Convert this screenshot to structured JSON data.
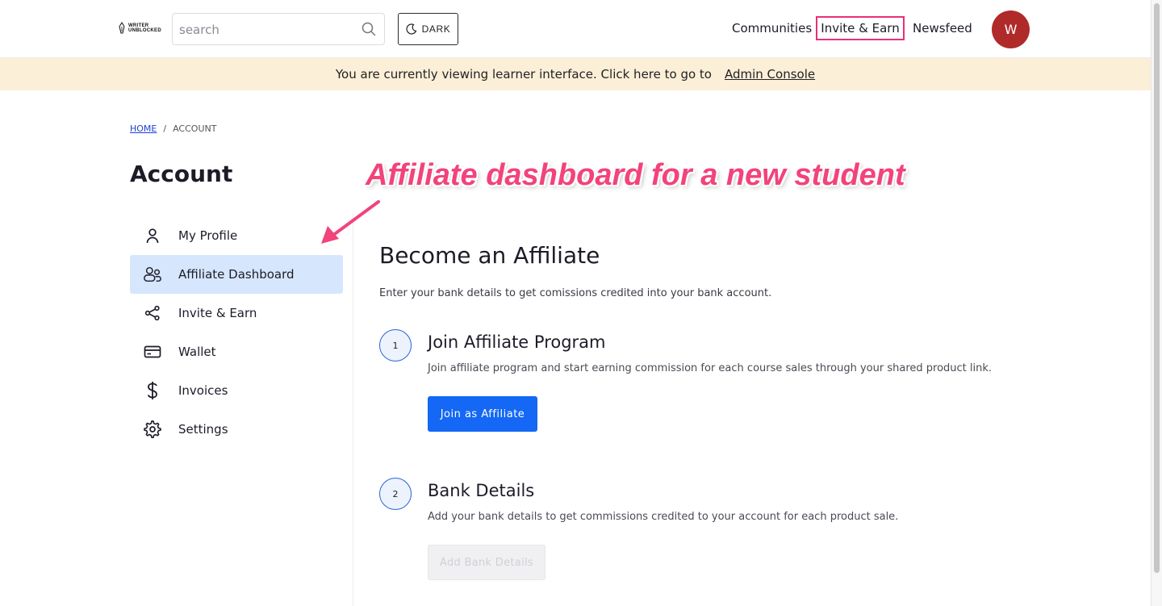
{
  "header": {
    "logo_text_line1": "WRITER",
    "logo_text_line2": "UNBLOCKED",
    "search_placeholder": "search",
    "dark_label": "DARK",
    "nav": [
      "Communities",
      "Invite & Earn",
      "Newsfeed"
    ],
    "avatar_initial": "W"
  },
  "banner": {
    "text": "You are currently viewing learner interface. Click here to go to",
    "link": "Admin Console"
  },
  "breadcrumb": {
    "home": "HOME",
    "separator": "/",
    "current": "ACCOUNT"
  },
  "page_title": "Account",
  "sidebar": {
    "items": [
      {
        "label": "My Profile",
        "icon": "user-icon",
        "active": false
      },
      {
        "label": "Affiliate Dashboard",
        "icon": "users-icon",
        "active": true
      },
      {
        "label": "Invite & Earn",
        "icon": "share-icon",
        "active": false
      },
      {
        "label": "Wallet",
        "icon": "credit-card-icon",
        "active": false
      },
      {
        "label": "Invoices",
        "icon": "dollar-icon",
        "active": false
      },
      {
        "label": "Settings",
        "icon": "gear-icon",
        "active": false
      }
    ]
  },
  "annotation": "Affiliate dashboard for a new student",
  "main": {
    "title": "Become an Affiliate",
    "subtitle": "Enter your bank details to get comissions credited into your bank account.",
    "steps": [
      {
        "number": "1",
        "title": "Join Affiliate Program",
        "desc": "Join affiliate program and start earning commission for each course sales through your shared product link.",
        "button": "Join as Affiliate"
      },
      {
        "number": "2",
        "title": "Bank Details",
        "desc": "Add your bank details to get commissions credited to your account for each product sale.",
        "button": "Add Bank Details"
      }
    ]
  },
  "colors": {
    "primary": "#1468f5",
    "active_bg": "#d6e6fd",
    "banner_bg": "#fcefd8",
    "avatar_bg": "#b02a2a",
    "annotation": "#f2437b",
    "highlight_border": "#e8307a"
  }
}
